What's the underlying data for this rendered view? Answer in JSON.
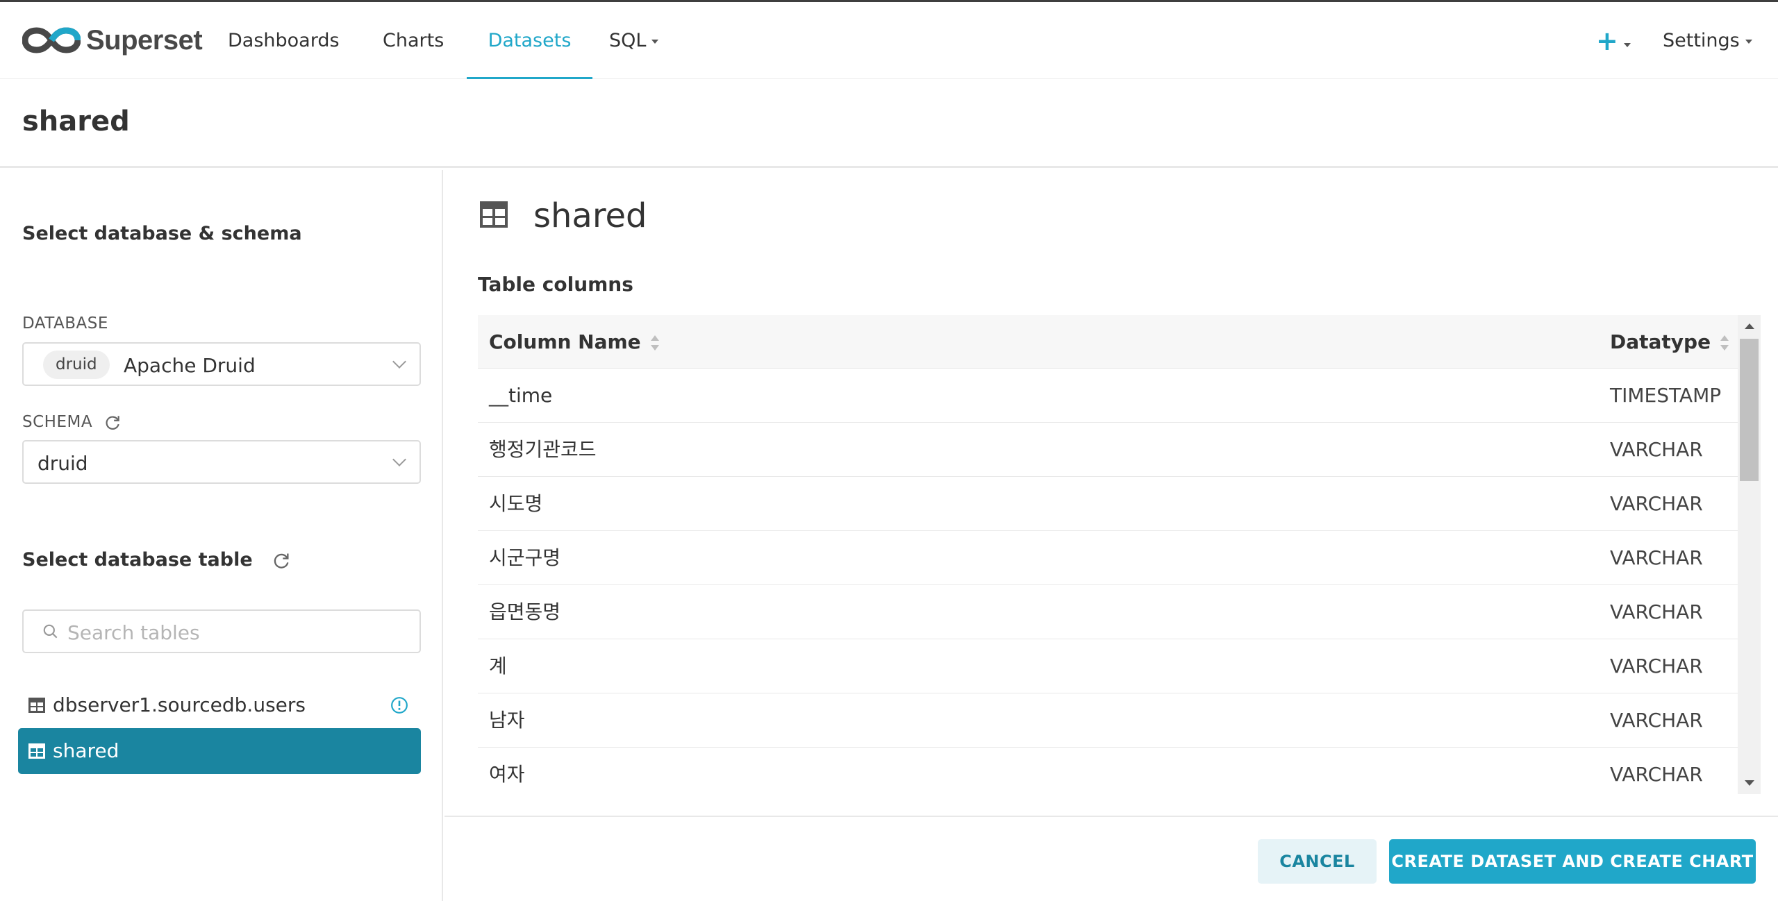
{
  "app": {
    "name": "Superset"
  },
  "nav": {
    "items": [
      {
        "label": "Dashboards"
      },
      {
        "label": "Charts"
      },
      {
        "label": "Datasets",
        "active": true
      },
      {
        "label": "SQL"
      }
    ],
    "plus_icon": "plus-icon",
    "settings_label": "Settings"
  },
  "page": {
    "title": "shared"
  },
  "left": {
    "heading_db_schema": "Select database & schema",
    "database_label": "DATABASE",
    "database_tag": "druid",
    "database_value": "Apache Druid",
    "schema_label": "SCHEMA",
    "schema_value": "druid",
    "heading_table": "Select database table",
    "search_placeholder": "Search tables",
    "tables": [
      {
        "name": "dbserver1.sourcedb.users",
        "selected": false
      },
      {
        "name": "shared",
        "selected": true
      }
    ]
  },
  "right": {
    "title": "shared",
    "subtitle": "Table columns",
    "headers": {
      "column_name": "Column Name",
      "datatype": "Datatype"
    },
    "rows": [
      {
        "name": "__time",
        "type": "TIMESTAMP"
      },
      {
        "name": "행정기관코드",
        "type": "VARCHAR"
      },
      {
        "name": "시도명",
        "type": "VARCHAR"
      },
      {
        "name": "시군구명",
        "type": "VARCHAR"
      },
      {
        "name": "읍면동명",
        "type": "VARCHAR"
      },
      {
        "name": "계",
        "type": "VARCHAR"
      },
      {
        "name": "남자",
        "type": "VARCHAR"
      },
      {
        "name": "여자",
        "type": "VARCHAR"
      }
    ]
  },
  "footer": {
    "cancel_label": "CANCEL",
    "create_label": "CREATE DATASET AND CREATE CHART"
  },
  "colors": {
    "accent": "#20a7c9",
    "selected_bg": "#1a85a0",
    "info_icon": "#20a7c9"
  }
}
